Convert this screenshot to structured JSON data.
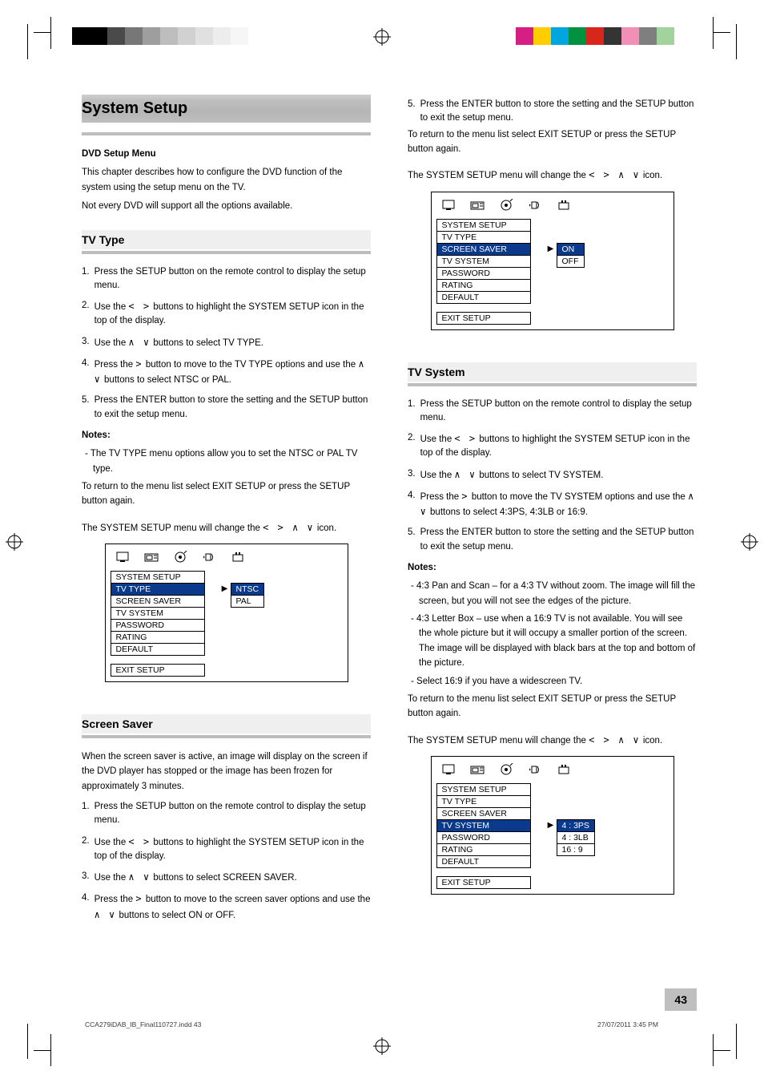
{
  "swatches_left": [
    "#000000",
    "#000000",
    "#4a4a4a",
    "#777777",
    "#9e9e9e",
    "#bdbdbd",
    "#d1d1d1",
    "#e0e0e0",
    "#ededed",
    "#f6f6f6"
  ],
  "swatches_right": [
    "#d61f85",
    "#ffcd00",
    "#00a6dd",
    "#00923f",
    "#d9261c",
    "#343434",
    "#f28fb6",
    "#7f7f7f",
    "#a2d39c",
    "#ffffff"
  ],
  "left": {
    "h1": "System Setup",
    "intro_heading": "DVD Setup Menu",
    "intro_line1": "This chapter describes how to configure the DVD function of the system using the setup menu on the TV.",
    "intro_line2": "Not every DVD will support all the options available.",
    "h2a": "TV Type",
    "step1": "Press the SETUP button on the remote control to display the setup menu.",
    "step2_a": "Use the ",
    "step2_b": " buttons  to  highlight  the  SYSTEM SETUP icon in the top of the display.",
    "step3_a": "Use the ",
    "step3_b": " buttons to select  TV TYPE.",
    "step4_a": "Press the ",
    "step4_arrow": ">",
    "step4_b": " button to move to the TV TYPE options and use the ",
    "step4_b2": " buttons to select NTSC or PAL.",
    "step5": "Press  the  ENTER  button  to  store  the  setting  and the SETUP button to exit the setup menu.",
    "notes_head": "Notes:",
    "note1": "-  The TV TYPE menu options allow you to set the NTSC or PAL TV type.",
    "backto": "To return to the menu list select EXIT SETUP or press the SETUP button again.",
    "menu_cap_a": "The SYSTEM SETUP menu will change the ",
    "menu_cap_b": " icon.",
    "h2b": "Screen Saver",
    "ss_line": "When the screen saver is active, an image will display on the screen if the DVD player has stopped or the image has been frozen for approximately 3 minutes.",
    "ss_s1": "Press the SETUP button on the remote control to display the setup menu.",
    "ss_s2_a": "Use the ",
    "ss_s2_b": " buttons to highlight the SYSTEM SETUP icon in the top of the display.",
    "ss_s3_a": "Use the ",
    "ss_s3_b": " buttons to select SCREEN SAVER.",
    "ss_s4_a": "Press the ",
    "ss_s4_arrow": ">",
    "ss_s4_b": " button to move to the screen saver options and use the ",
    "ss_s4_b2": " buttons to select ON or OFF."
  },
  "right": {
    "cont5": "Press  the  ENTER  button  to  store  the  setting  and the SETUP button to exit the setup menu.",
    "backto": "To return to the menu list select EXIT SETUP or press the SETUP button again.",
    "menu_cap_a": "The SYSTEM SETUP menu will change the ",
    "menu_cap_b": " icon.",
    "h2a": "TV System",
    "ts_s1": "Press the SETUP button on the remote control to display the setup menu.",
    "ts_s2_a": "Use the ",
    "ts_s2_b": " buttons to highlight the SYSTEM SETUP icon in the top of the display.",
    "ts_s3_a": "Use the ",
    "ts_s3_b": " buttons to select TV SYSTEM.",
    "ts_s4_a": "Press the ",
    "ts_s4_arrow": ">",
    "ts_s4_b": " button to move the TV SYSTEM options and use the ",
    "ts_s4_b2": "",
    "ts_s4_c": "buttons to select 4:3PS, 4:3LB or 16:9.",
    "ts_s5": "Press  the  ENTER  button  to  store  the  setting  and the SETUP button to exit the setup menu.",
    "notes_head": "Notes:",
    "ts_note1": "-  4:3 Pan and Scan – for a 4:3 TV without zoom.  The image will fill the screen, but you will not see the edges of the picture.",
    "ts_note2": "-  4:3 Letter Box – use when a 16:9 TV is not available. You will see the whole picture but it will occupy a smaller portion of the screen.  The image will be displayed with black bars at the top and bottom of the picture.",
    "ts_note3": "-  Select 16:9 if you have a widescreen TV.",
    "backto2": "To return to the menu list select EXIT SETUP or press the SETUP button again.",
    "menu_cap2_a": "The SYSTEM SETUP menu will change the ",
    "menu_cap2_b": " icon."
  },
  "arrows_lr": "<  >",
  "arrows_ud": "∧  ∨",
  "arrows_all": "<  >  ∧  ∨",
  "osd_labels": {
    "header": "SYSTEM SETUP",
    "items": [
      "TV TYPE",
      "SCREEN SAVER",
      "TV SYSTEM",
      "PASSWORD",
      "RATING",
      "DEFAULT"
    ],
    "exit": "EXIT SETUP"
  },
  "osd1": {
    "selected_left": "TV TYPE",
    "options": [
      "NTSC",
      "PAL"
    ],
    "selected_right": "NTSC"
  },
  "osd2": {
    "selected_left": "SCREEN SAVER",
    "options": [
      "ON",
      "OFF"
    ],
    "selected_right": "ON"
  },
  "osd3": {
    "selected_left": "TV SYSTEM",
    "options": [
      "4 : 3PS",
      "4 : 3LB",
      "16 : 9"
    ],
    "selected_right": "4 : 3PS"
  },
  "pagenum": "43",
  "footer_file": "CCA279iDAB_IB_Final110727.indd   43",
  "footer_date": "27/07/2011   3:45 PM"
}
